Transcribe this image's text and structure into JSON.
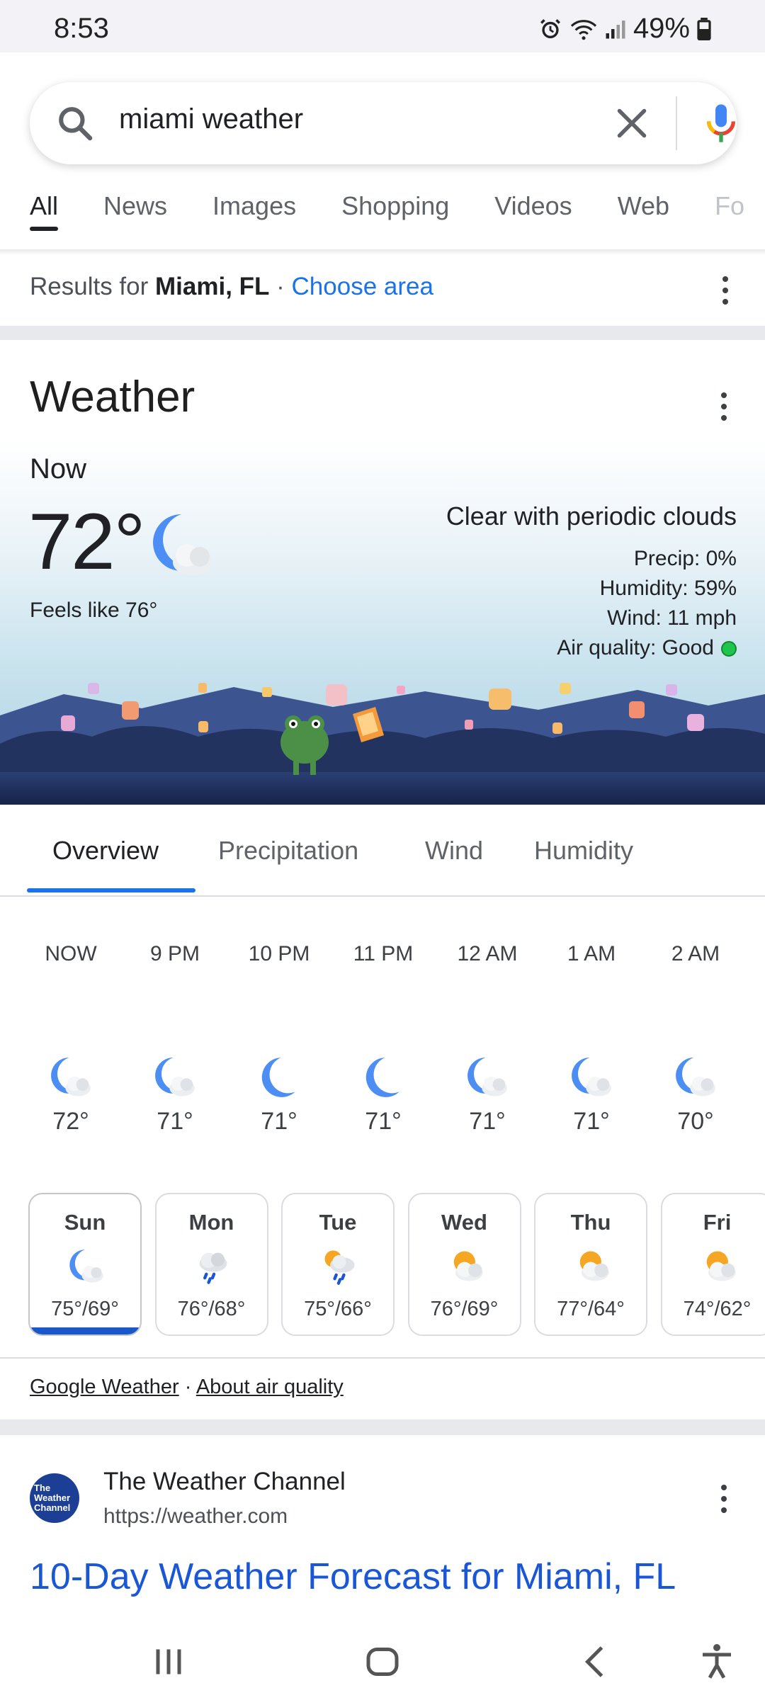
{
  "status_bar": {
    "time": "8:53",
    "battery": "49%"
  },
  "search": {
    "query": "miami weather"
  },
  "tabs": [
    "All",
    "News",
    "Images",
    "Shopping",
    "Videos",
    "Web",
    "Fo"
  ],
  "results_for": {
    "prefix": "Results for ",
    "location": "Miami, FL",
    "separator": " · ",
    "choose_area": "Choose area"
  },
  "weather": {
    "title": "Weather",
    "now_label": "Now",
    "temperature": "72°",
    "feels_like": "Feels like 76°",
    "condition": "Clear with periodic clouds",
    "precip": "Precip: 0%",
    "humidity": "Humidity: 59%",
    "wind": "Wind: 11 mph",
    "air_quality": "Air quality: Good",
    "sub_tabs": [
      "Overview",
      "Precipitation",
      "Wind",
      "Humidity"
    ],
    "hourly": [
      {
        "time": "NOW",
        "temp": "72°",
        "icon": "moon-cloud-icon"
      },
      {
        "time": "9 PM",
        "temp": "71°",
        "icon": "moon-cloud-icon"
      },
      {
        "time": "10 PM",
        "temp": "71°",
        "icon": "moon-icon"
      },
      {
        "time": "11 PM",
        "temp": "71°",
        "icon": "moon-icon"
      },
      {
        "time": "12 AM",
        "temp": "71°",
        "icon": "moon-cloud-icon"
      },
      {
        "time": "1 AM",
        "temp": "71°",
        "icon": "moon-cloud-icon"
      },
      {
        "time": "2 AM",
        "temp": "70°",
        "icon": "moon-cloud-icon"
      }
    ],
    "daily": [
      {
        "day": "Sun",
        "temps": "75°/69°",
        "icon": "moon-cloud-icon"
      },
      {
        "day": "Mon",
        "temps": "76°/68°",
        "icon": "rain-cloud-icon"
      },
      {
        "day": "Tue",
        "temps": "75°/66°",
        "icon": "sun-rain-cloud-icon"
      },
      {
        "day": "Wed",
        "temps": "76°/69°",
        "icon": "partly-cloudy-icon"
      },
      {
        "day": "Thu",
        "temps": "77°/64°",
        "icon": "partly-cloudy-icon"
      },
      {
        "day": "Fri",
        "temps": "74°/62°",
        "icon": "partly-cloudy-icon"
      }
    ],
    "footer": {
      "google_weather": "Google Weather",
      "dot": " · ",
      "about_air": "About air quality"
    }
  },
  "result": {
    "logo_text": "The Weather Channel",
    "site_name": "The Weather Channel",
    "url": "https://weather.com",
    "title": "10-Day Weather Forecast for Miami, FL"
  },
  "colors": {
    "accent": "#1a73e8",
    "aq_good": "#1fc44c",
    "sky_bottom": "#a8cee0",
    "ground": "#1d2b52"
  }
}
